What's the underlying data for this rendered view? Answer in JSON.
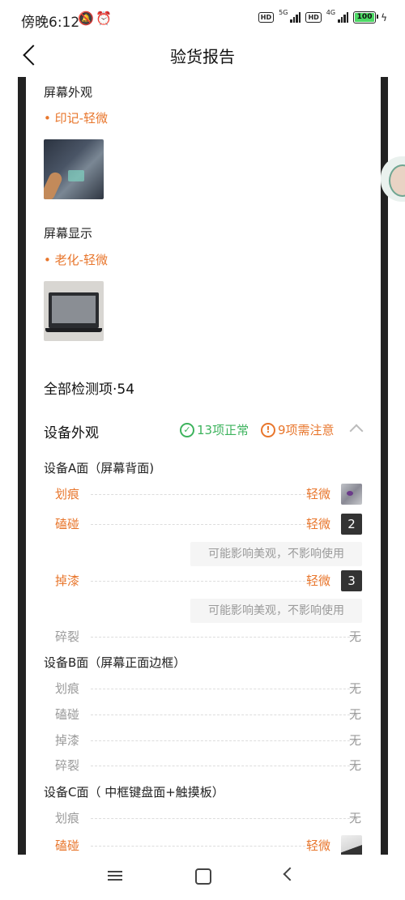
{
  "status_bar": {
    "time": "傍晚6:12",
    "net1": "5G",
    "net2": "4G",
    "hd": "HD",
    "battery": "100"
  },
  "header": {
    "title": "验货报告"
  },
  "screen_appearance": {
    "label": "屏幕外观",
    "issue": "• 印记-轻微"
  },
  "screen_display": {
    "label": "屏幕显示",
    "issue": "• 老化-轻微"
  },
  "total": "全部检测项·54",
  "section": {
    "title": "设备外观",
    "ok_text": "13项正常",
    "warn_text": "9项需注意",
    "ok_icon": "✓",
    "warn_icon": "!"
  },
  "group_a": {
    "title": "设备A面（屏幕背面)",
    "rows": [
      {
        "name": "划痕",
        "value": "轻微"
      },
      {
        "name": "磕碰",
        "value": "轻微",
        "pic": "2",
        "note": "可能影响美观，不影响使用"
      },
      {
        "name": "掉漆",
        "value": "轻微",
        "pic": "3",
        "note": "可能影响美观，不影响使用"
      },
      {
        "name": "碎裂",
        "value": "无"
      }
    ]
  },
  "group_b": {
    "title": "设备B面（屏幕正面边框）",
    "rows": [
      {
        "name": "划痕",
        "value": "无"
      },
      {
        "name": "磕碰",
        "value": "无"
      },
      {
        "name": "掉漆",
        "value": "无"
      },
      {
        "name": "碎裂",
        "value": "无"
      }
    ]
  },
  "group_c": {
    "title": "设备C面（ 中框键盘面+触摸板）",
    "rows": [
      {
        "name": "划痕",
        "value": "无"
      },
      {
        "name": "磕碰",
        "value": "轻微"
      }
    ]
  },
  "colors": {
    "accent": "#e8762c",
    "ok": "#3db35d",
    "muted": "#9a9a9a"
  }
}
